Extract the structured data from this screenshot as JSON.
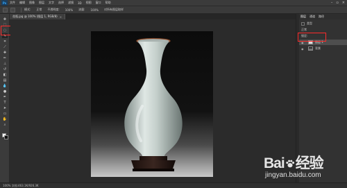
{
  "app": {
    "logo": "Ps"
  },
  "menubar": {
    "items": [
      "文件",
      "编辑",
      "图像",
      "图层",
      "文字",
      "选择",
      "滤镜",
      "3D",
      "视图",
      "窗口",
      "帮助"
    ]
  },
  "optionsbar": {
    "items": [
      "模式:",
      "正常",
      "不透明度:",
      "100%",
      "流量:",
      "100%",
      "对所有图层取样"
    ]
  },
  "document_tab": {
    "title": "花瓶.jpg @ 100% (图层 1, RGB/8)",
    "close": "×"
  },
  "panels": {
    "tabs": [
      "图层",
      "通道",
      "路径"
    ],
    "rows": [
      "类型",
      "正常",
      "锁定:",
      "图层 1",
      "背景"
    ]
  },
  "statusbar": {
    "text": "100%  文档:463.1K/926.3K"
  },
  "watermark": {
    "brand_left": "Bai",
    "brand_right": "经验",
    "url": "jingyan.baidu.com"
  },
  "colors": {
    "highlight": "#ff2a2a",
    "ui_background": "#2b2b2b",
    "panel": "#3b3b3b"
  },
  "icons": {
    "tools": [
      "move-icon",
      "marquee-icon",
      "lasso-icon",
      "quick-select-icon",
      "crop-icon",
      "eyedropper-icon",
      "healing-brush-icon",
      "brush-icon",
      "clone-stamp-icon",
      "history-brush-icon",
      "eraser-icon",
      "gradient-icon",
      "blur-icon",
      "dodge-icon",
      "pen-icon",
      "type-icon",
      "path-select-icon",
      "shape-icon",
      "hand-icon",
      "zoom-icon"
    ]
  }
}
